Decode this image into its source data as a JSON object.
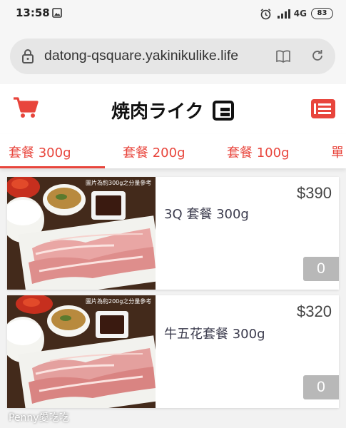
{
  "status_bar": {
    "time": "13:58",
    "network": "4G",
    "battery": "83"
  },
  "browser": {
    "url": "datong-qsquare.yakinikulike.life"
  },
  "header": {
    "logo_text": "焼肉ライク"
  },
  "tabs": [
    {
      "label": "套餐 300g",
      "active": true
    },
    {
      "label": "套餐 200g",
      "active": false
    },
    {
      "label": "套餐 100g",
      "active": false
    },
    {
      "label": "單",
      "active": false
    }
  ],
  "products": [
    {
      "name": "3Q 套餐 300g",
      "price": "$390",
      "quantity": "0",
      "photo_note": "圖片為約300g之分量參考"
    },
    {
      "name": "牛五花套餐 300g",
      "price": "$320",
      "quantity": "0",
      "photo_note": "圖片為約200g之分量參考"
    }
  ],
  "watermark": "Penny愛吃吃",
  "colors": {
    "accent": "#e8453c",
    "text": "#3b3b4d",
    "badge": "#b8b8b8"
  }
}
